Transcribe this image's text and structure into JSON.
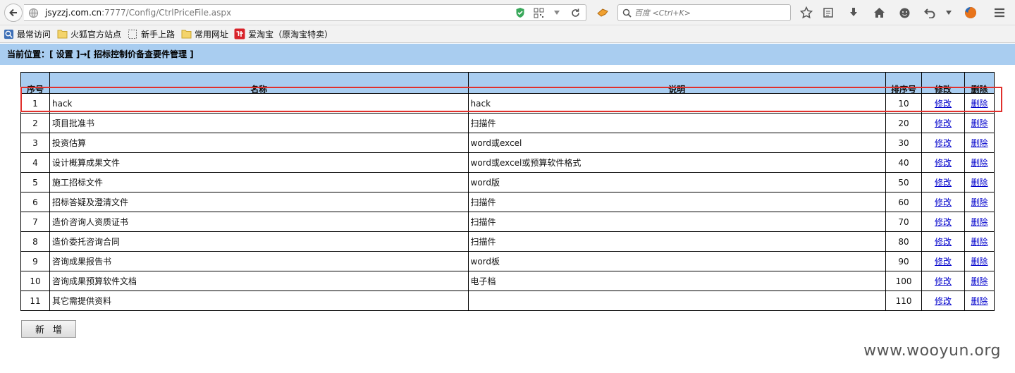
{
  "browser": {
    "url_host": "jsyzzj.com.cn",
    "url_path": ":7777/Config/CtrlPriceFile.aspx",
    "search_placeholder": "百度 <Ctrl+K>"
  },
  "bookmarks": [
    {
      "label": "最常访问",
      "icon": "globe-icon"
    },
    {
      "label": "火狐官方站点",
      "icon": "folder-icon"
    },
    {
      "label": "新手上路",
      "icon": "dotted-page-icon"
    },
    {
      "label": "常用网址",
      "icon": "folder-icon"
    },
    {
      "label": "爱淘宝（原淘宝特卖）",
      "icon": "taobao-icon"
    }
  ],
  "page": {
    "location": "当前位置：[ 设置 ]→[ 招标控制价备查要件管理 ]",
    "add_button": "新增"
  },
  "table": {
    "headers": {
      "no": "序号",
      "name": "名称",
      "desc": "说明",
      "sort": "排序号",
      "edit": "修改",
      "delete": "删除"
    },
    "rows": [
      {
        "no": "1",
        "name": "hack",
        "desc": "hack",
        "sort": "10",
        "edit": "修改",
        "delete": "删除"
      },
      {
        "no": "2",
        "name": "项目批准书",
        "desc": "扫描件",
        "sort": "20",
        "edit": "修改",
        "delete": "删除"
      },
      {
        "no": "3",
        "name": "投资估算",
        "desc": "word或excel",
        "sort": "30",
        "edit": "修改",
        "delete": "删除"
      },
      {
        "no": "4",
        "name": "设计概算成果文件",
        "desc": "word或excel或预算软件格式",
        "sort": "40",
        "edit": "修改",
        "delete": "删除"
      },
      {
        "no": "5",
        "name": "施工招标文件",
        "desc": "word版",
        "sort": "50",
        "edit": "修改",
        "delete": "删除"
      },
      {
        "no": "6",
        "name": "招标答疑及澄清文件",
        "desc": "扫描件",
        "sort": "60",
        "edit": "修改",
        "delete": "删除"
      },
      {
        "no": "7",
        "name": "造价咨询人资质证书",
        "desc": "扫描件",
        "sort": "70",
        "edit": "修改",
        "delete": "删除"
      },
      {
        "no": "8",
        "name": "造价委托咨询合同",
        "desc": "扫描件",
        "sort": "80",
        "edit": "修改",
        "delete": "删除"
      },
      {
        "no": "9",
        "name": "咨询成果报告书",
        "desc": "word板",
        "sort": "90",
        "edit": "修改",
        "delete": "删除"
      },
      {
        "no": "10",
        "name": "咨询成果预算软件文档",
        "desc": "电子档",
        "sort": "100",
        "edit": "修改",
        "delete": "删除"
      },
      {
        "no": "11",
        "name": "其它需提供资料",
        "desc": "",
        "sort": "110",
        "edit": "修改",
        "delete": "删除"
      }
    ]
  },
  "watermark": "www.wooyun.org",
  "colors": {
    "header_bg": "#a9cdf0",
    "highlight": "#e0302c",
    "link": "#0000cc"
  }
}
